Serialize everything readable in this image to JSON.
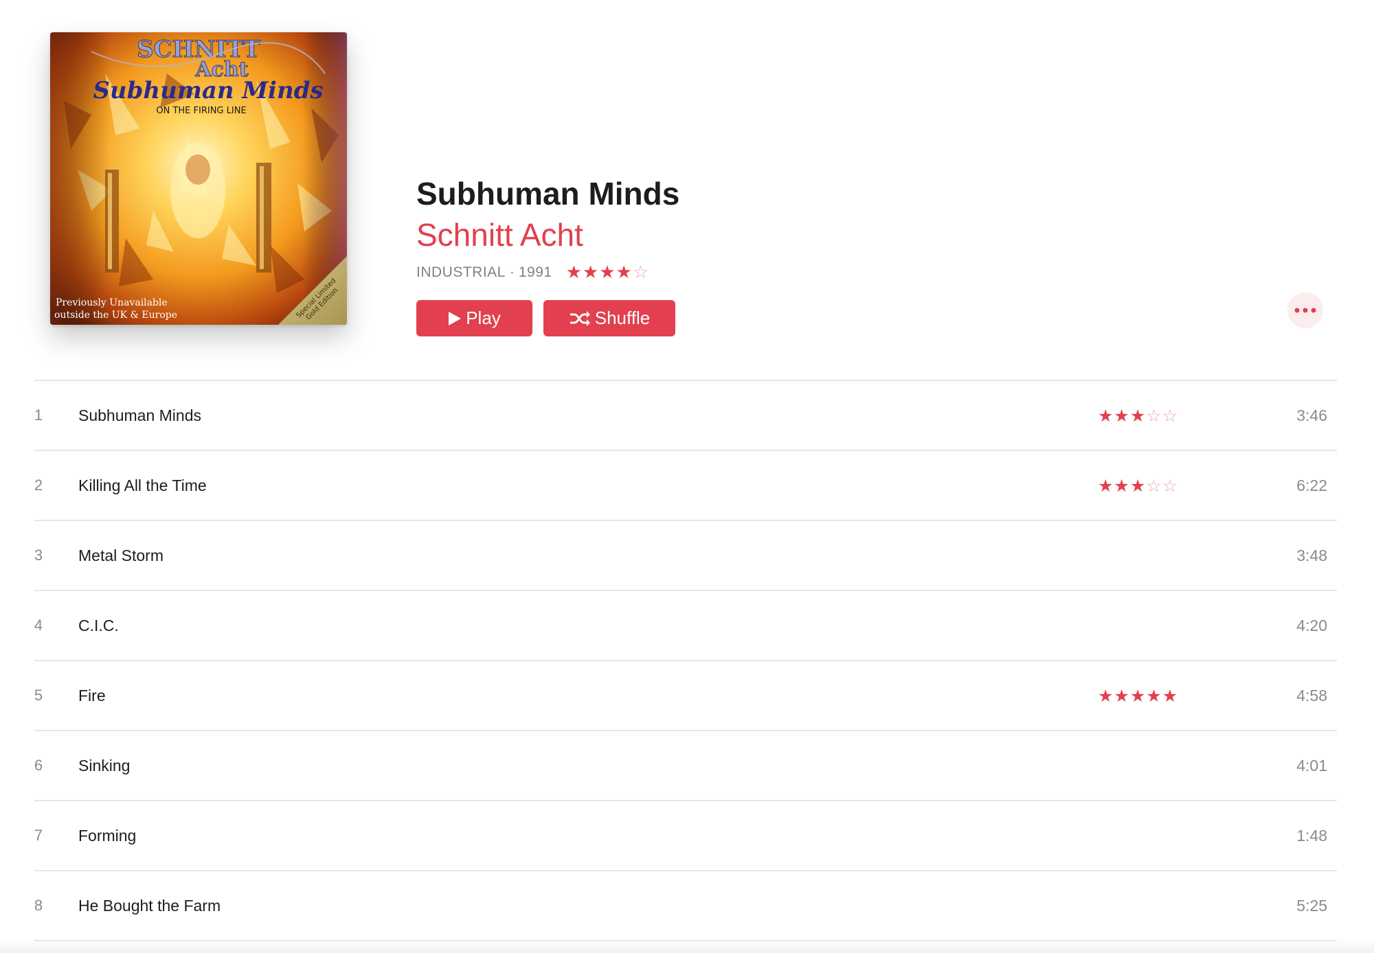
{
  "album": {
    "title": "Subhuman Minds",
    "artist": "Schnitt Acht",
    "genre": "INDUSTRIAL",
    "separator": "·",
    "year": "1991",
    "rating": 4,
    "rating_max": 5,
    "artwork": {
      "band_name": "SCHNITT",
      "band_name_2": "Acht",
      "album_script": "Subhuman Minds",
      "subtitle": "ON THE FIRING LINE",
      "note_line_1": "Previously Unavailable",
      "note_line_2": "outside the UK & Europe",
      "corner_line_1": "Special Limited",
      "corner_line_2": "Gold Edition"
    }
  },
  "actions": {
    "play_label": "Play",
    "shuffle_label": "Shuffle",
    "play_icon": "play-icon",
    "shuffle_icon": "shuffle-icon",
    "more_icon": "ellipsis-icon"
  },
  "colors": {
    "accent": "#e2404f",
    "accent_light": "#fbeced",
    "secondary_text": "#8a8a8e",
    "divider": "#e6e6e8"
  },
  "tracks": [
    {
      "number": "1",
      "title": "Subhuman Minds",
      "rating": 3,
      "duration": "3:46"
    },
    {
      "number": "2",
      "title": "Killing All the Time",
      "rating": 3,
      "duration": "6:22"
    },
    {
      "number": "3",
      "title": "Metal Storm",
      "rating": 0,
      "duration": "3:48"
    },
    {
      "number": "4",
      "title": "C.I.C.",
      "rating": 0,
      "duration": "4:20"
    },
    {
      "number": "5",
      "title": "Fire",
      "rating": 5,
      "duration": "4:58"
    },
    {
      "number": "6",
      "title": "Sinking",
      "rating": 0,
      "duration": "4:01"
    },
    {
      "number": "7",
      "title": "Forming",
      "rating": 0,
      "duration": "1:48"
    },
    {
      "number": "8",
      "title": "He Bought the Farm",
      "rating": 0,
      "duration": "5:25"
    }
  ]
}
